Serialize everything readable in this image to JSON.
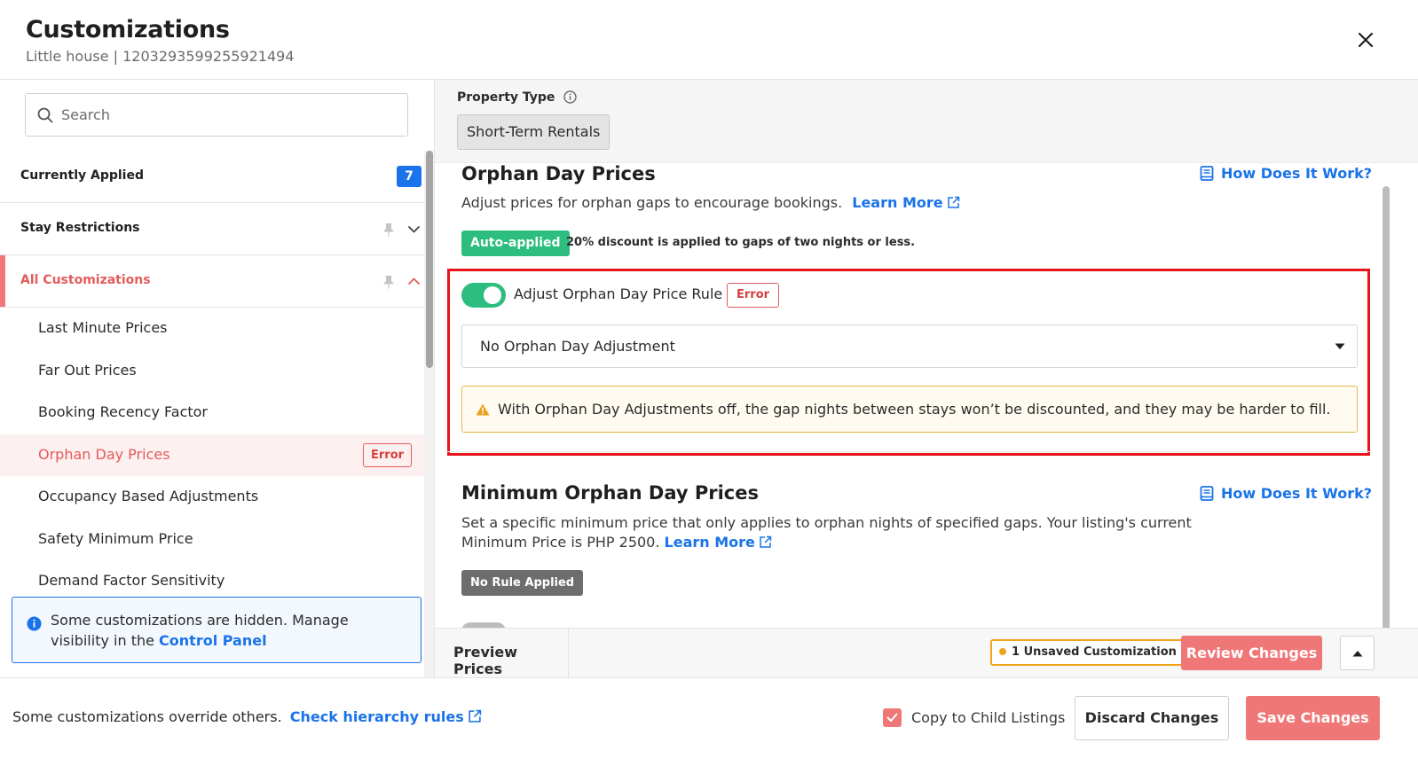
{
  "header": {
    "title": "Customizations",
    "subtitle": "Little house | 1203293599255921494"
  },
  "sidebar": {
    "search_placeholder": "Search",
    "sections": [
      {
        "label": "Currently Applied",
        "count": "7"
      },
      {
        "label": "Stay Restrictions"
      },
      {
        "label": "All Customizations"
      }
    ],
    "items": [
      {
        "label": "Last Minute Prices"
      },
      {
        "label": "Far Out Prices"
      },
      {
        "label": "Booking Recency Factor"
      },
      {
        "label": "Orphan Day Prices",
        "badge": "Error"
      },
      {
        "label": "Occupancy Based Adjustments"
      },
      {
        "label": "Safety Minimum Price"
      },
      {
        "label": "Demand Factor Sensitivity"
      }
    ],
    "hidden_note": {
      "text": "Some customizations are hidden. Manage visibility in the",
      "link": "Control Panel"
    }
  },
  "main": {
    "property_type_label": "Property Type",
    "property_type_value": "Short-Term Rentals",
    "orphan": {
      "title": "Orphan Day Prices",
      "how_link": "How Does It Work?",
      "desc": "Adjust prices for orphan gaps to encourage bookings.",
      "learn_more": "Learn More",
      "auto_badge": "Auto-applied",
      "auto_text": "20% discount is applied to gaps of two nights or less.",
      "rule_label": "Adjust Orphan Day Price Rule",
      "rule_badge": "Error",
      "select_value": "No Orphan Day Adjustment",
      "warning": "With Orphan Day Adjustments off, the gap nights between stays won’t be discounted, and they may be harder to fill."
    },
    "minimum": {
      "title": "Minimum Orphan Day Prices",
      "how_link": "How Does It Work?",
      "desc_line1": "Set a specific minimum price that only applies to orphan nights of specified gaps. Your listing's current",
      "desc_line2": "Minimum Price is PHP 2500.",
      "learn_more": "Learn More",
      "badge": "No Rule Applied"
    },
    "preview_bar": {
      "preview_tab": "Preview Prices",
      "unsaved": "1 Unsaved Customization",
      "review_button": "Review Changes"
    }
  },
  "footer": {
    "override_text": "Some customizations override others.",
    "hierarchy_link": "Check hierarchy rules",
    "copy_label": "Copy to Child Listings",
    "discard_button": "Discard Changes",
    "save_button": "Save Changes"
  },
  "colors": {
    "accent_blue": "#1a73e8",
    "brand_coral": "#f07777",
    "success_green": "#2dbd7e",
    "warning_amber": "#f1a41b",
    "error_red": "#e8141b"
  }
}
